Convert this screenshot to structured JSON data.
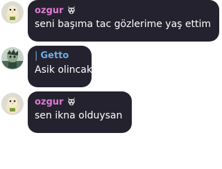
{
  "messages": [
    {
      "author": "ozgur",
      "name_color": "#e07ad2",
      "has_badge": true,
      "badge_icon": "goat-skull-icon",
      "avatar_icon": "chick-avatar-icon",
      "text": "seni başıma tac gözlerime yaş ettim"
    },
    {
      "author": "Getto",
      "name_color": "#6eaee6",
      "reply_marker": "|",
      "avatar_icon": "cartoon-avatar-icon",
      "text": "Asik olincak cuble"
    },
    {
      "author": "ozgur",
      "name_color": "#e07ad2",
      "has_badge": true,
      "badge_icon": "goat-skull-icon",
      "avatar_icon": "chick-avatar-icon",
      "text": "sen ikna olduysan"
    }
  ],
  "colors": {
    "bubble_bg": "#25222f",
    "text": "#ffffff",
    "page_bg": "#ffffff"
  }
}
